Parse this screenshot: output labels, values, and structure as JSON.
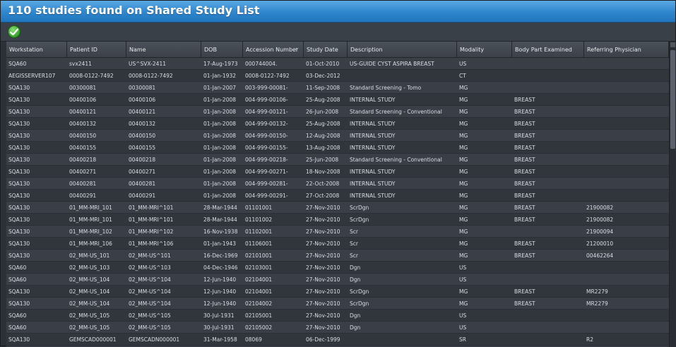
{
  "window": {
    "title": "110 studies found on Shared Study List"
  },
  "toolbar": {
    "ok_icon": "check-circle-icon",
    "ok_color": "#3eaa2f"
  },
  "colors": {
    "titlebar": "#2f86cc",
    "row_odd": "#3a3f47",
    "row_even": "#31363d"
  },
  "columns": [
    "Workstation",
    "Patient ID",
    "Name",
    "DOB",
    "Accession Number",
    "Study Date",
    "Description",
    "Modality",
    "Body Part Examined",
    "Referring Physician"
  ],
  "rows": [
    [
      "SQA60",
      "svx2411",
      "US^SVX-2411",
      "17-Aug-1973",
      "000744004.",
      "01-Oct-2010",
      "US-GUIDE CYST ASPIRA BREAST",
      "US",
      "",
      ""
    ],
    [
      "AEGISSERVER107",
      "0008-0122-7492",
      "0008-0122-7492",
      "01-Jan-1932",
      "0008-0122-7492",
      "03-Dec-2012",
      "",
      "CT",
      "",
      ""
    ],
    [
      "SQA130",
      "00300081",
      "00300081",
      "01-Jan-2007",
      "003-999-00081-",
      "11-Sep-2008",
      "Standard Screening - Tomo",
      "MG",
      "",
      ""
    ],
    [
      "SQA130",
      "00400106",
      "00400106",
      "01-Jan-2008",
      "004-999-00106-",
      "25-Aug-2008",
      "INTERNAL STUDY",
      "MG",
      "BREAST",
      ""
    ],
    [
      "SQA130",
      "00400121",
      "00400121",
      "01-Jan-2008",
      "004-999-00121-",
      "26-Jun-2008",
      "Standard Screening - Conventional",
      "MG",
      "BREAST",
      ""
    ],
    [
      "SQA130",
      "00400132",
      "00400132",
      "01-Jan-2008",
      "004-999-00132-",
      "25-Aug-2008",
      "INTERNAL STUDY",
      "MG",
      "BREAST",
      ""
    ],
    [
      "SQA130",
      "00400150",
      "00400150",
      "01-Jan-2008",
      "004-999-00150-",
      "12-Aug-2008",
      "INTERNAL STUDY",
      "MG",
      "BREAST",
      ""
    ],
    [
      "SQA130",
      "00400155",
      "00400155",
      "01-Jan-2008",
      "004-999-00155-",
      "13-Aug-2008",
      "INTERNAL STUDY",
      "MG",
      "BREAST",
      ""
    ],
    [
      "SQA130",
      "00400218",
      "00400218",
      "01-Jan-2008",
      "004-999-00218-",
      "25-Jun-2008",
      "Standard Screening - Conventional",
      "MG",
      "BREAST",
      ""
    ],
    [
      "SQA130",
      "00400271",
      "00400271",
      "01-Jan-2008",
      "004-999-00271-",
      "18-Nov-2008",
      "INTERNAL STUDY",
      "MG",
      "BREAST",
      ""
    ],
    [
      "SQA130",
      "00400281",
      "00400281",
      "01-Jan-2008",
      "004-999-00281-",
      "22-Oct-2008",
      "INTERNAL STUDY",
      "MG",
      "BREAST",
      ""
    ],
    [
      "SQA130",
      "00400291",
      "00400291",
      "01-Jan-2008",
      "004-999-00291-",
      "27-Oct-2008",
      "INTERNAL STUDY",
      "MG",
      "BREAST",
      ""
    ],
    [
      "SQA130",
      "01_MM-MRI_101",
      "01_MM-MRI^101",
      "28-Mar-1944",
      "01101001",
      "27-Nov-2010",
      "ScrDgn",
      "MG",
      "BREAST",
      "21900082"
    ],
    [
      "SQA130",
      "01_MM-MRI_101",
      "01_MM-MRI^101",
      "28-Mar-1944",
      "01101002",
      "27-Nov-2010",
      "ScrDgn",
      "MG",
      "BREAST",
      "21900082"
    ],
    [
      "SQA130",
      "01_MM-MRI_102",
      "01_MM-MRI^102",
      "16-Nov-1938",
      "01102001",
      "27-Nov-2010",
      "Scr",
      "MG",
      "",
      "21900094"
    ],
    [
      "SQA130",
      "01_MM-MRI_106",
      "01_MM-MRI^106",
      "01-Jan-1943",
      "01106001",
      "27-Nov-2010",
      "Scr",
      "MG",
      "BREAST",
      "21200010"
    ],
    [
      "SQA130",
      "02_MM-US_101",
      "02_MM-US^101",
      "16-Dec-1969",
      "02101001",
      "27-Nov-2010",
      "Scr",
      "MG",
      "BREAST",
      "00462264"
    ],
    [
      "SQA60",
      "02_MM-US_103",
      "02_MM-US^103",
      "04-Dec-1946",
      "02103001",
      "27-Nov-2010",
      "Dgn",
      "US",
      "",
      ""
    ],
    [
      "SQA60",
      "02_MM-US_104",
      "02_MM-US^104",
      "12-Jun-1940",
      "02104001",
      "27-Nov-2010",
      "Dgn",
      "US",
      "",
      ""
    ],
    [
      "SQA130",
      "02_MM-US_104",
      "02_MM-US^104",
      "12-Jun-1940",
      "02104001",
      "27-Nov-2010",
      "ScrDgn",
      "MG",
      "BREAST",
      "MR2279"
    ],
    [
      "SQA130",
      "02_MM-US_104",
      "02_MM-US^104",
      "12-Jun-1940",
      "02104002",
      "27-Nov-2010",
      "ScrDgn",
      "MG",
      "BREAST",
      "MR2279"
    ],
    [
      "SQA60",
      "02_MM-US_105",
      "02_MM-US^105",
      "30-Jul-1931",
      "02105001",
      "27-Nov-2010",
      "Dgn",
      "US",
      "",
      ""
    ],
    [
      "SQA60",
      "02_MM-US_105",
      "02_MM-US^105",
      "30-Jul-1931",
      "02105002",
      "27-Nov-2010",
      "Dgn",
      "US",
      "",
      ""
    ],
    [
      "SQA130",
      "GEMSCAD000001",
      "GEMSCADN000001",
      "31-Mar-1958",
      "08069",
      "06-Dec-1999",
      "",
      "SR",
      "",
      "R2"
    ]
  ]
}
